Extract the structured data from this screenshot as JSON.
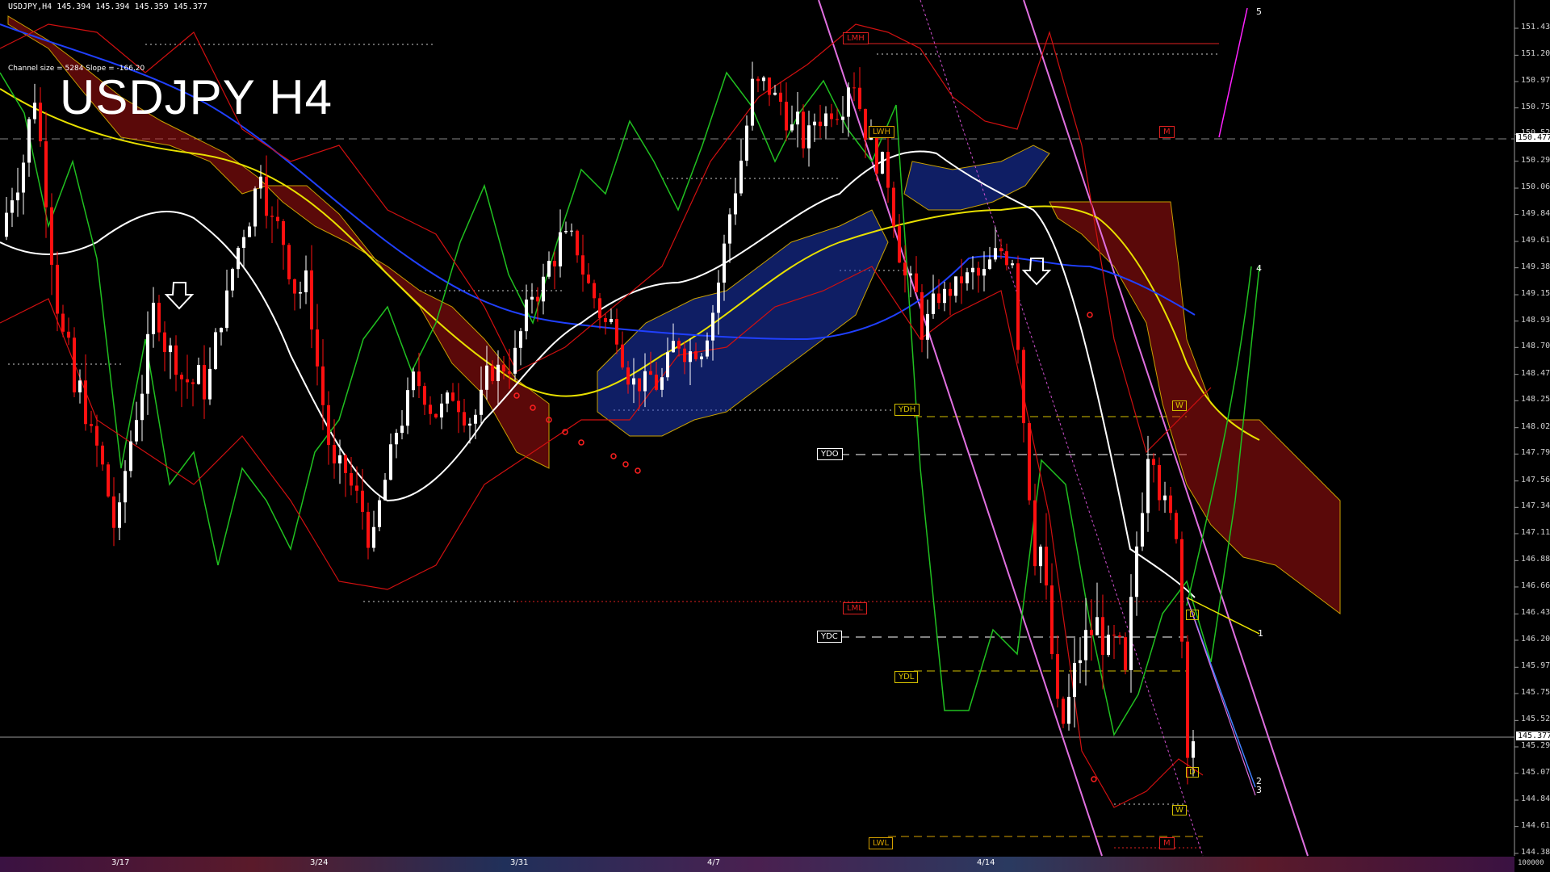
{
  "header": {
    "symbol_line": "USDJPY,H4  145.394 145.394 145.359 145.377"
  },
  "title": "USDJPY H4",
  "channel_info": "Channel size = 5284 Slope = -166.20",
  "current_price": "145.377",
  "upper_price_tag": "150.477",
  "axis_bottom": "100000",
  "chart_data": {
    "type": "line",
    "price_ticks": [
      "151.430",
      "151.200",
      "150.975",
      "150.750",
      "150.525",
      "150.295",
      "150.065",
      "149.840",
      "149.610",
      "149.385",
      "149.155",
      "148.930",
      "148.705",
      "148.475",
      "148.250",
      "148.020",
      "147.795",
      "147.565",
      "147.340",
      "147.115",
      "146.885",
      "146.660",
      "146.430",
      "146.205",
      "145.975",
      "145.750",
      "145.520",
      "145.295",
      "145.070",
      "144.840",
      "144.615",
      "144.385"
    ],
    "ylim": [
      144.385,
      151.43
    ],
    "x_labels": [
      "3/17",
      "3/24",
      "3/31",
      "4/7",
      "4/14"
    ],
    "levels": [
      {
        "label": "LMH",
        "color": "#e02020"
      },
      {
        "label": "LWH",
        "color": "#d4a000"
      },
      {
        "label": "M",
        "color": "#e02020"
      },
      {
        "label": "YDH",
        "color": "#d4c000"
      },
      {
        "label": "YDO",
        "color": "#ffffff"
      },
      {
        "label": "LML",
        "color": "#e02020"
      },
      {
        "label": "YDC",
        "color": "#ffffff"
      },
      {
        "label": "YDL",
        "color": "#d4c000"
      },
      {
        "label": "LWL",
        "color": "#d4a000"
      },
      {
        "label": "M",
        "color": "#e02020"
      }
    ],
    "dw_markers": [
      "W",
      "D",
      "D",
      "W"
    ],
    "wave_labels": [
      "5",
      "4",
      "1",
      "2",
      "3"
    ]
  }
}
